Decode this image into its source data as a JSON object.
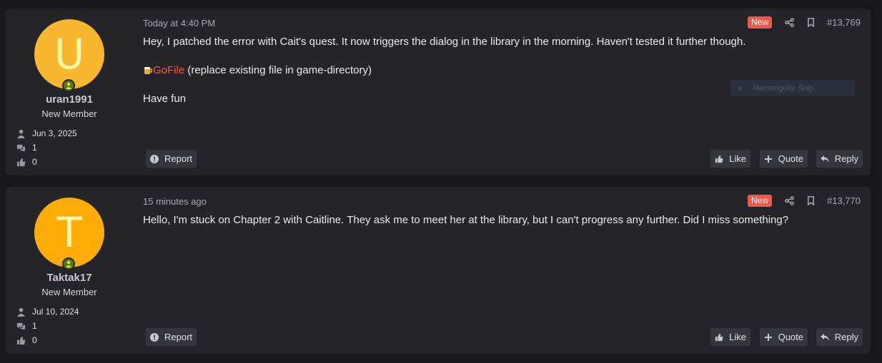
{
  "posts": [
    {
      "avatar_letter": "U",
      "username": "uran1991",
      "user_title": "New Member",
      "joined": "Jun 3, 2025",
      "messages": "1",
      "reactions": "0",
      "timestamp": "Today at 4:40 PM",
      "badge": "New",
      "post_number": "#13,769",
      "body": {
        "line1": "Hey, I patched the error with Cait's quest. It now triggers the dialog in the library in the morning. Haven't tested it further though.",
        "link_text": "GoFile",
        "link_suffix": " (replace existing file in game-directory)",
        "line3": "Have fun"
      },
      "overlay_text": "Rectangular Snip"
    },
    {
      "avatar_letter": "T",
      "username": "Taktak17",
      "user_title": "New Member",
      "joined": "Jul 10, 2024",
      "messages": "1",
      "reactions": "0",
      "timestamp": "15 minutes ago",
      "badge": "New",
      "post_number": "#13,770",
      "body": {
        "line1": "Hello, I'm stuck on Chapter 2 with Caitline. They ask me to meet her at the library, but I can't progress any further. Did I miss something?"
      }
    }
  ],
  "actions": {
    "report": "Report",
    "like": "Like",
    "quote": "Quote",
    "reply": "Reply"
  },
  "colors": {
    "background": "#17171b",
    "post_bg": "#242429",
    "badge_new": "#f0584b",
    "link": "#f05b4a",
    "online": "#5d7a12"
  },
  "icons": [
    "user-icon",
    "comments-icon",
    "thumbs-up-icon",
    "share-icon",
    "bookmark-icon",
    "report-icon",
    "plus-icon",
    "reply-icon",
    "beer-icon"
  ]
}
